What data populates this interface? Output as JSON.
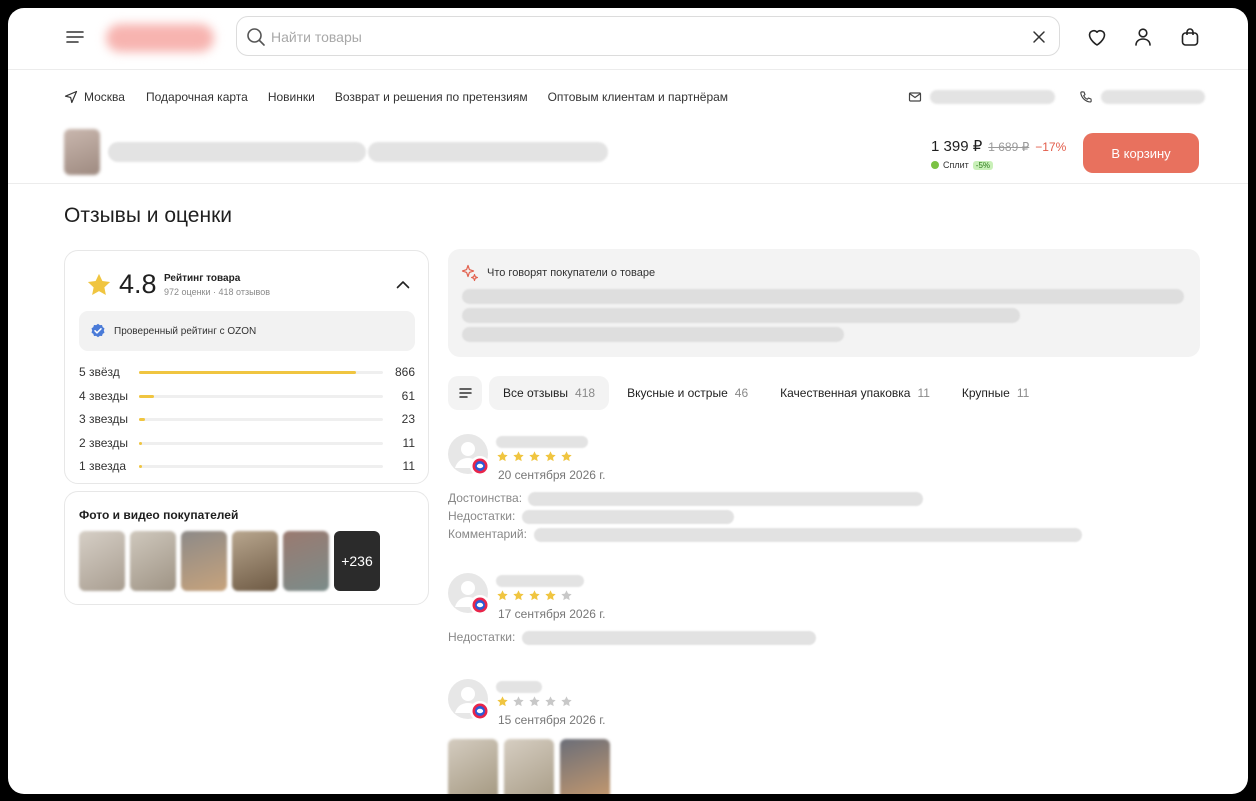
{
  "header": {
    "search_placeholder": "Найти товары",
    "icons": [
      "menu-icon",
      "search-icon",
      "close-icon",
      "heart-icon",
      "user-icon",
      "bag-icon"
    ]
  },
  "subnav": {
    "city": "Москва",
    "links": [
      "Подарочная карта",
      "Новинки",
      "Возврат и решения по претензиям",
      "Оптовым клиентам и партнёрам"
    ]
  },
  "product": {
    "price": "1 399 ₽",
    "old_price": "1 689 ₽",
    "discount": "−17%",
    "split_label": "Сплит",
    "split_discount": "-5%",
    "cart_button": "В корзину"
  },
  "page_title": "Отзывы и оценки",
  "rating": {
    "score": "4.8",
    "label": "Рейтинг товара",
    "sub": "972 оценки · 418 отзывов",
    "verified": "Проверенный рейтинг с OZON",
    "bars": [
      {
        "label": "5 звёзд",
        "count": "866",
        "fraction": 0.89
      },
      {
        "label": "4 звезды",
        "count": "61",
        "fraction": 0.06
      },
      {
        "label": "3 звезды",
        "count": "23",
        "fraction": 0.025
      },
      {
        "label": "2 звезды",
        "count": "11",
        "fraction": 0.012
      },
      {
        "label": "1 звезда",
        "count": "11",
        "fraction": 0.012
      }
    ],
    "colors": {
      "star": "#f0c540",
      "verified": "#4a7bd8"
    }
  },
  "photos": {
    "title": "Фото и видео покупателей",
    "more": "+236"
  },
  "summary": {
    "title": "Что говорят покупатели о товаре"
  },
  "filters": [
    {
      "label": "Все отзывы",
      "count": "418",
      "active": true
    },
    {
      "label": "Вкусные и острые",
      "count": "46",
      "active": false
    },
    {
      "label": "Качественная упаковка",
      "count": "11",
      "active": false
    },
    {
      "label": "Крупные",
      "count": "11",
      "active": false
    }
  ],
  "reviews": [
    {
      "stars": 5,
      "date": "20 сентября 2026 г.",
      "fields": [
        "Достоинства:",
        "Недостатки:",
        "Комментарий:"
      ]
    },
    {
      "stars": 4,
      "date": "17 сентября 2026 г.",
      "fields": [
        "Недостатки:"
      ]
    },
    {
      "stars": 1,
      "date": "15 сентября 2026 г.",
      "fields": []
    }
  ]
}
